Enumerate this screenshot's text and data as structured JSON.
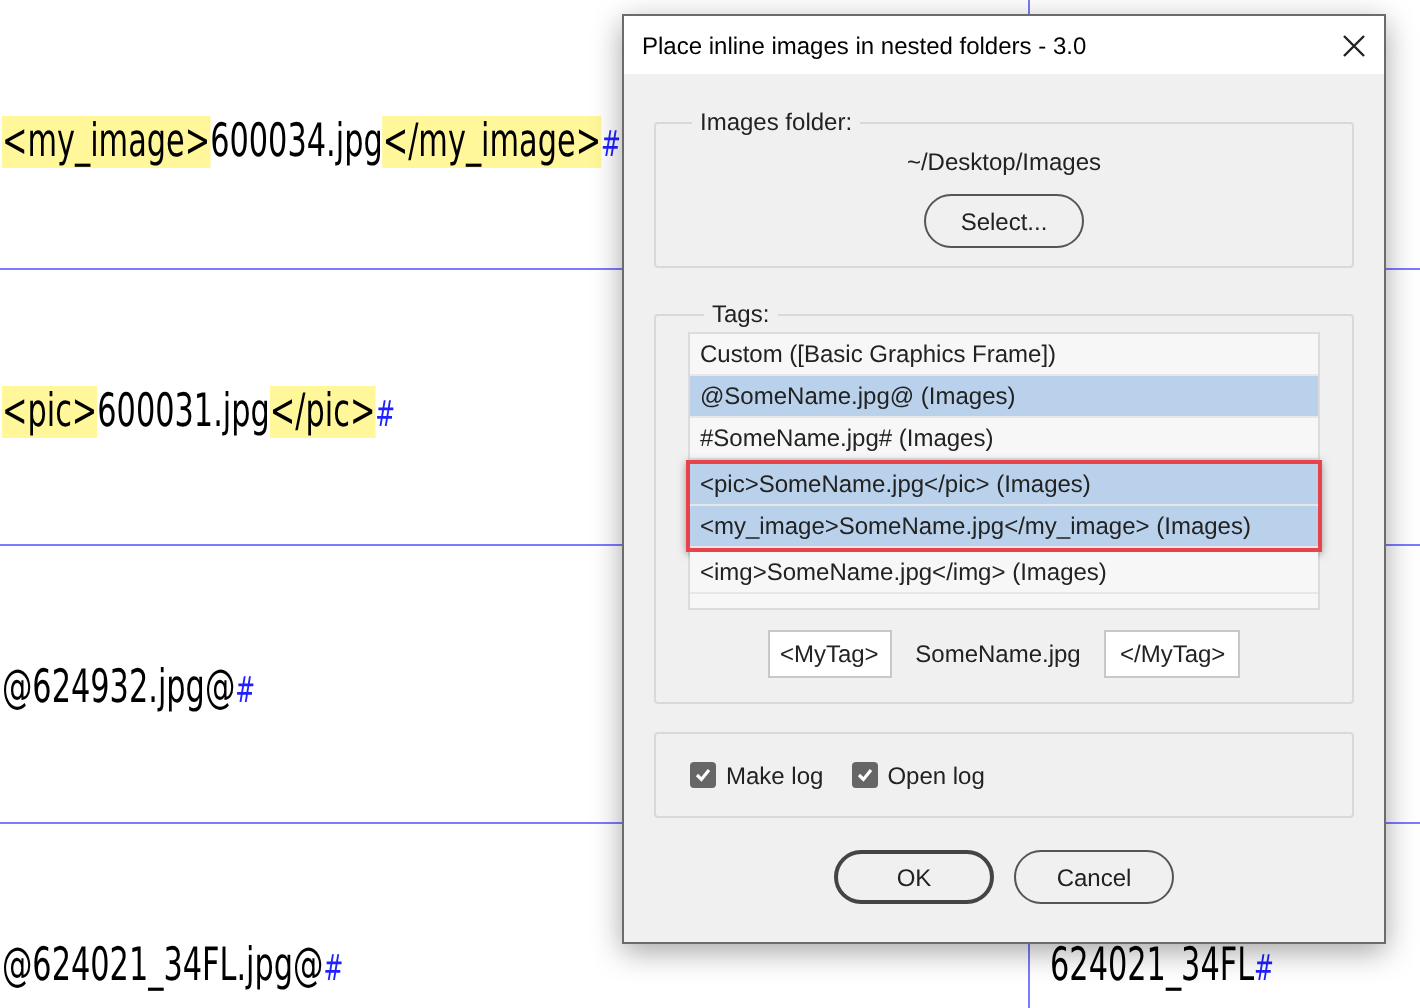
{
  "document": {
    "rows": [
      {
        "left": [
          {
            "kind": "tag",
            "text": "<my_image>"
          },
          {
            "kind": "name",
            "text": "600034.jpg"
          },
          {
            "kind": "tag",
            "text": "</my_image>"
          },
          {
            "kind": "marker",
            "text": "#"
          }
        ]
      },
      {
        "left": [
          {
            "kind": "tag",
            "text": "<pic>"
          },
          {
            "kind": "name",
            "text": "600031.jpg"
          },
          {
            "kind": "tag",
            "text": "</pic>"
          },
          {
            "kind": "marker",
            "text": "#"
          }
        ]
      },
      {
        "left": [
          {
            "kind": "name",
            "text": "@624932.jpg@"
          },
          {
            "kind": "marker",
            "text": "#"
          }
        ]
      },
      {
        "left": [
          {
            "kind": "name",
            "text": "@624021_34FL.jpg@"
          },
          {
            "kind": "marker",
            "text": "#"
          }
        ],
        "right": [
          {
            "kind": "name",
            "text": "624021_34FL"
          },
          {
            "kind": "marker",
            "text": "#"
          }
        ]
      }
    ]
  },
  "dialog": {
    "title": "Place inline images in nested folders - 3.0",
    "images_folder": {
      "label": "Images folder:",
      "path": "~/Desktop/Images",
      "button": "Select..."
    },
    "tags": {
      "label": "Tags:",
      "items": [
        {
          "text": "Custom ([Basic Graphics Frame])",
          "selected": false,
          "highlighted": false
        },
        {
          "text": "@SomeName.jpg@ (Images)",
          "selected": true,
          "highlighted": false
        },
        {
          "text": "#SomeName.jpg# (Images)",
          "selected": false,
          "highlighted": false
        },
        {
          "text": "<pic>SomeName.jpg</pic> (Images)",
          "selected": true,
          "highlighted": true
        },
        {
          "text": "<my_image>SomeName.jpg</my_image> (Images)",
          "selected": true,
          "highlighted": true
        },
        {
          "text": "<img>SomeName.jpg</img> (Images)",
          "selected": false,
          "highlighted": false
        }
      ],
      "open_tag": "<MyTag>",
      "sample": "SomeName.jpg",
      "close_tag": "</MyTag>"
    },
    "options": [
      {
        "label": "Make log",
        "checked": true
      },
      {
        "label": "Open log",
        "checked": true
      }
    ],
    "buttons": [
      {
        "label": "OK",
        "default": true
      },
      {
        "label": "Cancel",
        "default": false
      }
    ]
  }
}
